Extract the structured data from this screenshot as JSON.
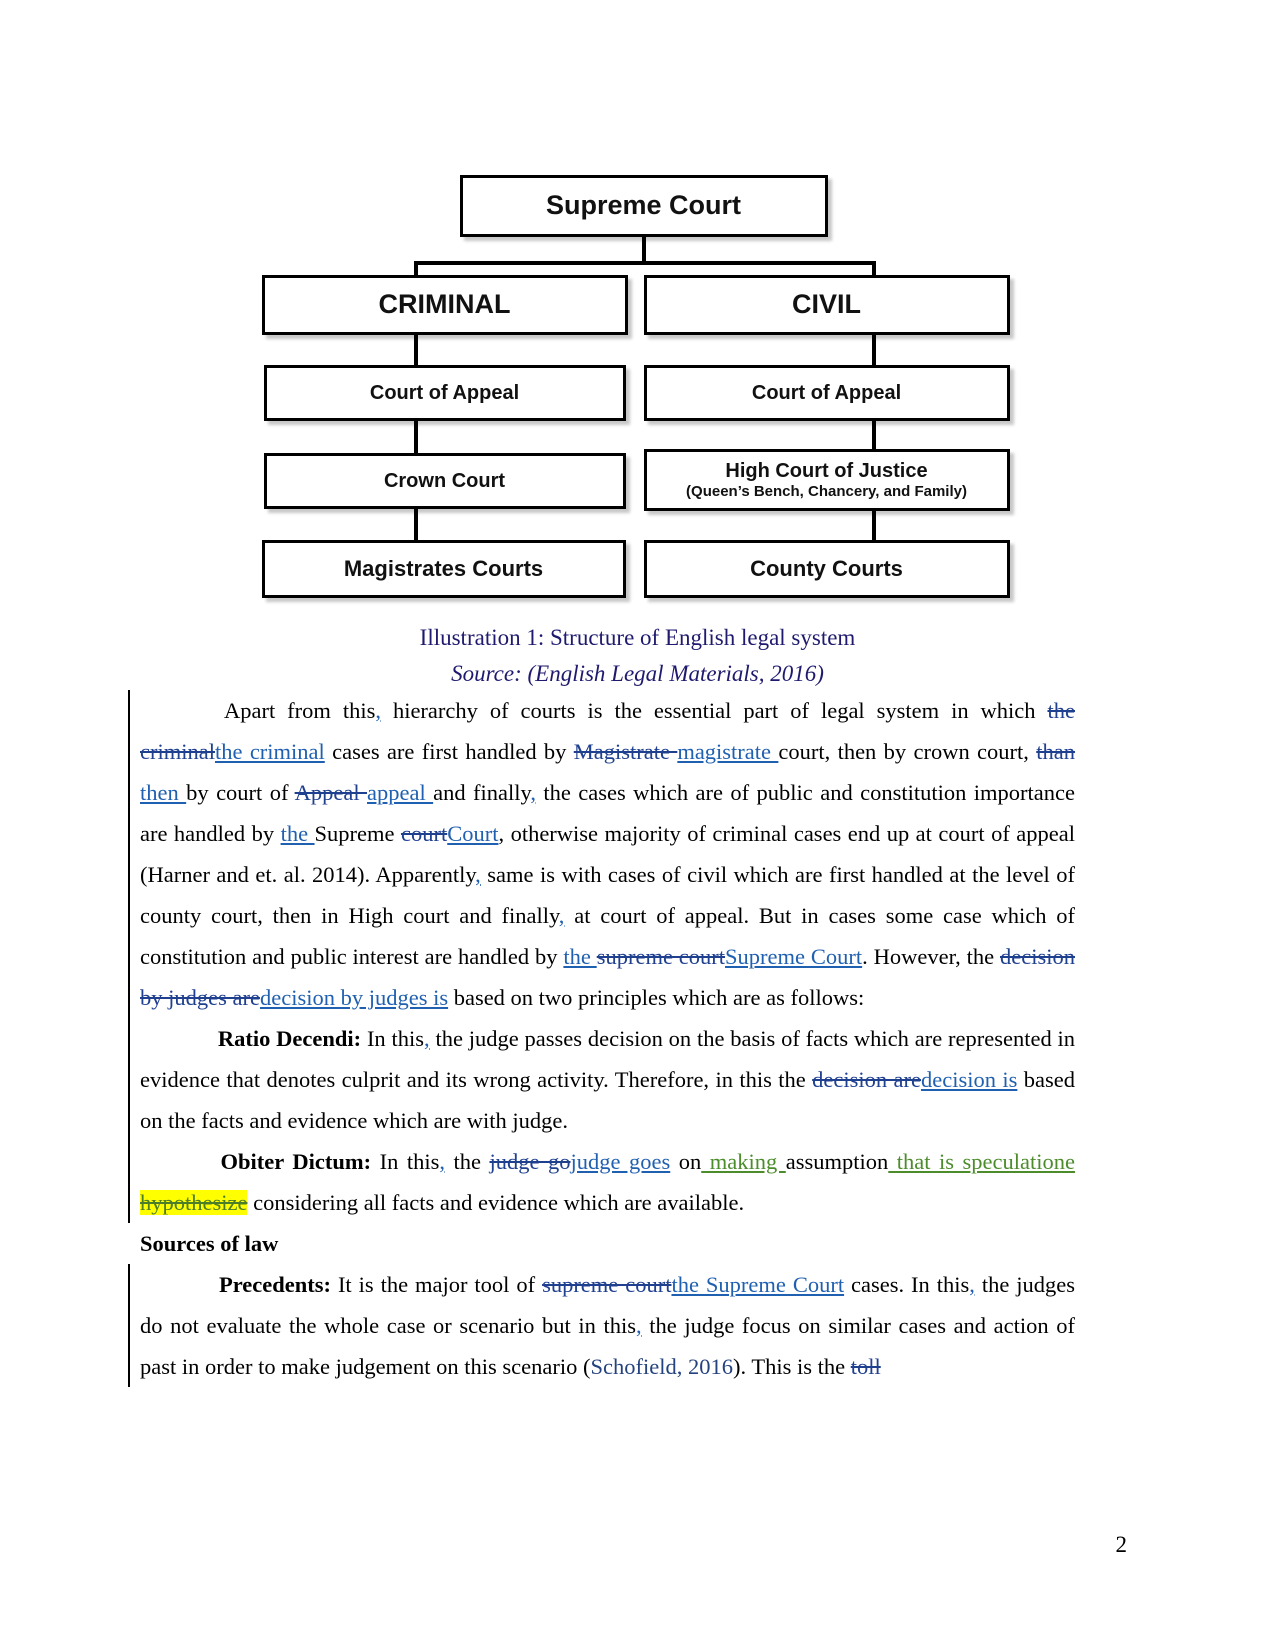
{
  "document": {
    "page_number": "2"
  },
  "figure": {
    "nodes": {
      "supreme": "Supreme Court",
      "criminal": "CRIMINAL",
      "civil": "CIVIL",
      "court_of_appeal_criminal": "Court of Appeal",
      "court_of_appeal_civil": "Court of Appeal",
      "crown_court": "Crown Court",
      "high_court": "High Court of Justice",
      "high_court_sub": "(Queen’s Bench, Chancery, and Family)",
      "magistrates_courts": "Magistrates Courts",
      "county_courts": "County Courts"
    },
    "caption": "Illustration 1: Structure of English legal system",
    "source": "Source: (English Legal Materials, 2016)",
    "caption_color": "#1f1a6e"
  },
  "revision_colors": {
    "author1_insert": "#2060b0",
    "author1_delete": "#1f3f8f",
    "author2_insert": "#4c8c2b",
    "author2_delete": "#4c7d28",
    "highlight": "#ffff00"
  },
  "paragraphs": {
    "p1": {
      "t1": "Apart from this",
      "ins_comma1": ",",
      "t2": " hierarchy of courts is the essential part of legal system in which ",
      "del1": "the criminal",
      "ins1": "the criminal",
      "t3": " cases are first handled by ",
      "del2": "Magistrate ",
      "ins2": "magistrate ",
      "t4": "court, then by crown court, ",
      "del3": "than ",
      "ins3": "then ",
      "t5": "by court of ",
      "del4": "Appeal ",
      "ins4": "appeal ",
      "t6": "and finally",
      "ins_comma2": ",",
      "t7": " the cases which are of public and constitution importance are handled by ",
      "ins5": "the ",
      "t8": "Supreme ",
      "del5": "court",
      "ins6": "Court",
      "t9": ", otherwise majority of criminal cases end up at court of appeal (Harner and et. al. 2014). Apparently",
      "ins_comma3": ",",
      "t10": " same is with cases of civil which are first handled at the level of county court, then in High court and finally",
      "ins_comma4": ",",
      "t11": " at court of appeal. But in cases some case which of constitution and public interest are handled by ",
      "ins7": "the ",
      "del6": "supreme court",
      "ins8": "Supreme Court",
      "t12": ". However, the ",
      "del7": "decision by judges are",
      "ins9": "decision by judges is",
      "t13": " based on two principles which are as follows:"
    },
    "p2": {
      "lead": "Ratio Decendi:",
      "t1": " In this",
      "ins_comma1": ",",
      "t2": " the judge passes decision on the basis of facts which are represented in evidence that denotes culprit and its wrong activity. Therefore, in this the ",
      "del1": "decision are",
      "ins1": "decision is",
      "t3": " based on the facts and evidence which are with judge."
    },
    "p3": {
      "lead": "Obiter Dictum:",
      "t1": " In this",
      "ins_comma1": ",",
      "t2": " the ",
      "del1": "judge go",
      "ins1": "judge goes",
      "t3": " on",
      "ins2": " making ",
      "t4": "assumption",
      "ins3": " that is speculatione",
      "del2": " hypothesize",
      "t5": " considering all facts and evidence which are available."
    },
    "heading_sources": "Sources of law",
    "p4": {
      "lead": "Precedents:",
      "t1": " It is the major tool of ",
      "del1": "supreme court",
      "ins1": "the Supreme Court",
      "t2": " cases. In this",
      "ins_comma1": ",",
      "t3": " the judges do not evaluate the whole case or scenario but in this",
      "ins_comma2": ",",
      "t4": " the judge focus on similar cases and action of past in order to make judgement on this scenario (",
      "cite": "Schofield, 2016",
      "t5": "). This is the ",
      "del2": "toll"
    }
  }
}
